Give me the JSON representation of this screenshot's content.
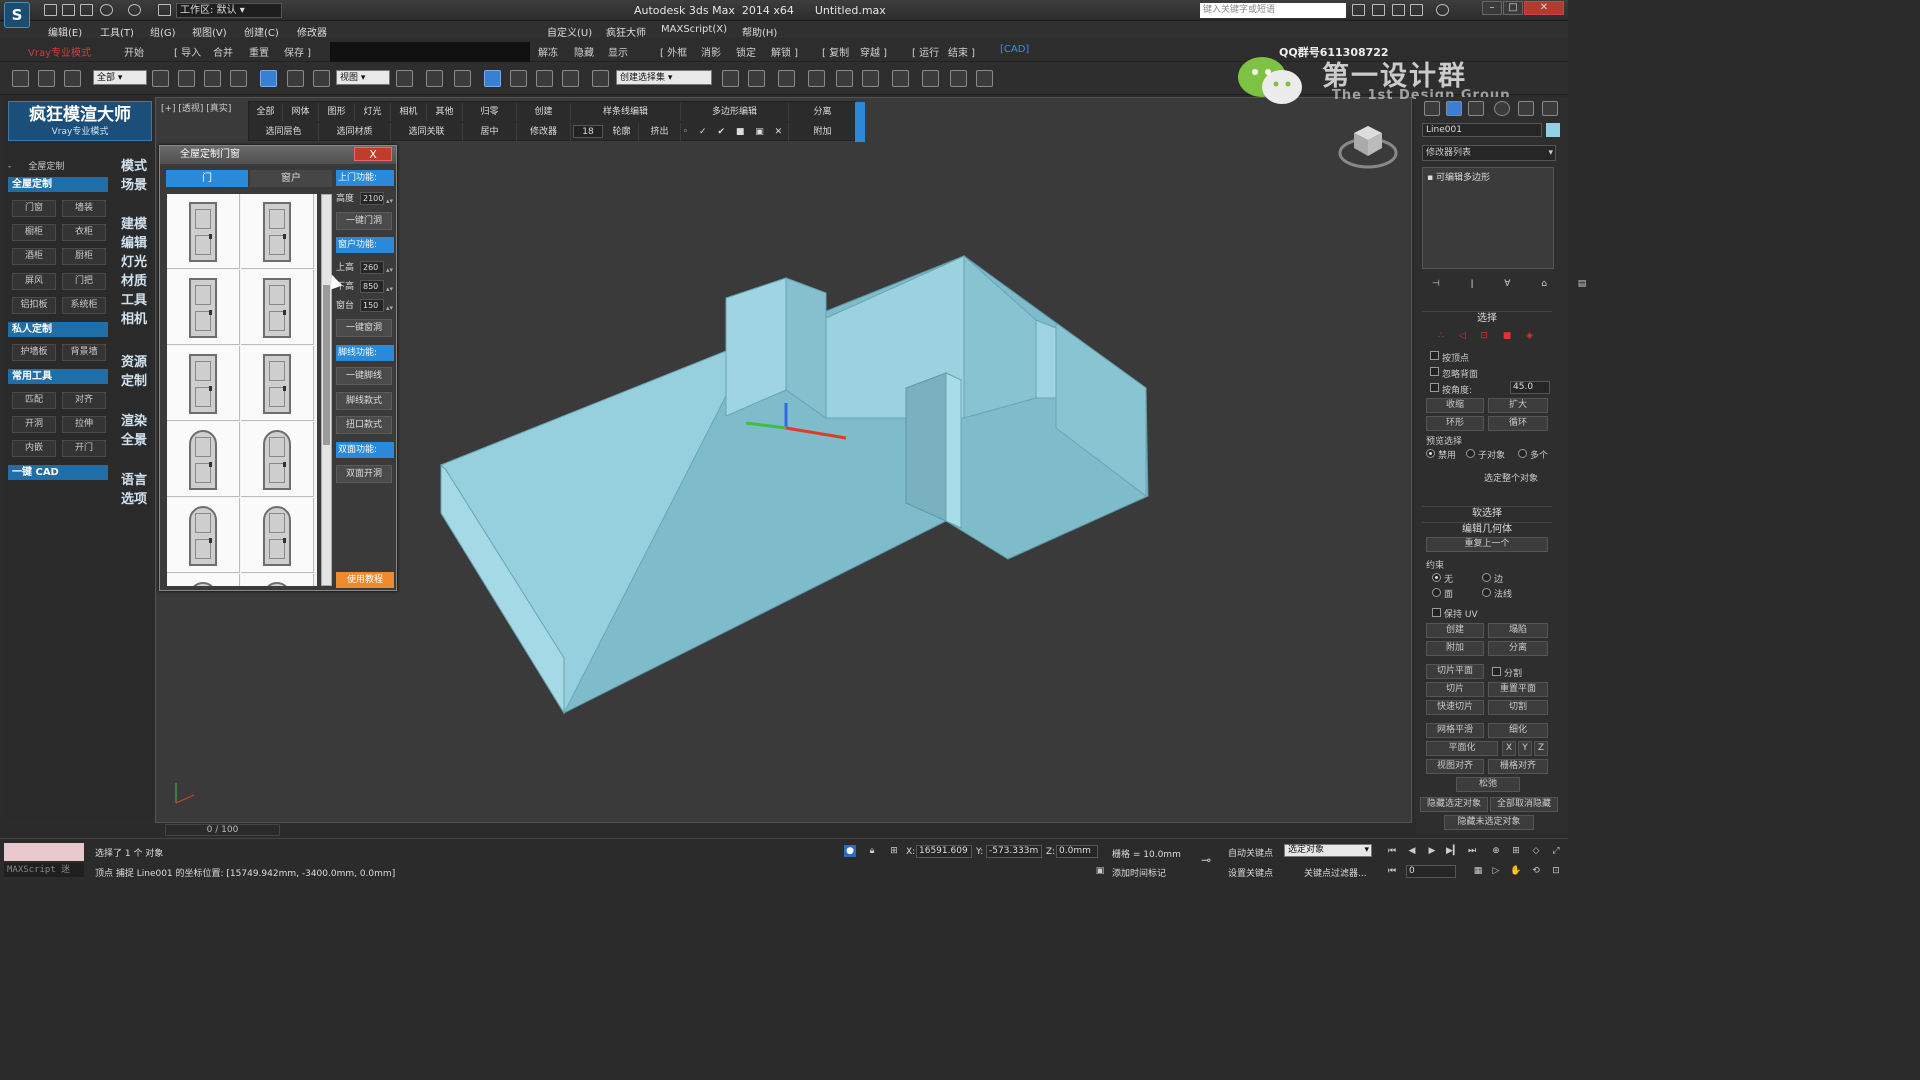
{
  "titlebar": {
    "workspace_prefix": "工作区:",
    "workspace_value": "默认",
    "app_title": "Autodesk 3ds Max  2014 x64",
    "file_name": "Untitled.max",
    "search_placeholder": "键入关键字或短语"
  },
  "menubar": {
    "items": [
      "编辑(E)",
      "工具(T)",
      "组(G)",
      "视图(V)",
      "创建(C)",
      "修改器",
      "自定义(U)",
      "疯狂大师",
      "MAXScript(X)",
      "帮助(H)"
    ]
  },
  "plugin_strip": {
    "items": [
      "开始",
      "[ 导入",
      "合并",
      "重置",
      "保存 ]",
      "解冻",
      "隐藏",
      "显示",
      "[ 外框",
      "消影",
      "锁定",
      "解锁 ]",
      "[ 复制",
      "穿越 ]",
      "[ 运行",
      "结束 ]",
      "[CAD]"
    ],
    "brand_text": "Vray专业模式"
  },
  "toolbar": {
    "filter_value": "全部",
    "ref_coord_value": "视图",
    "named_selection_value": "创建选择集"
  },
  "left_panel": {
    "brand_title": "疯狂模渲大师",
    "brand_subtitle": "Vray专业模式",
    "group_label": "全屋定制",
    "sections": [
      {
        "title": "全屋定制",
        "buttons": [
          "门窗",
          "墙装",
          "橱柜",
          "衣柜",
          "酒柜",
          "厨柜",
          "屏风",
          "门把",
          "铝扣板",
          "系统柜"
        ]
      },
      {
        "title": "私人定制",
        "buttons": [
          "护墙板",
          "背景墙"
        ]
      },
      {
        "title": "常用工具",
        "buttons": [
          "匹配",
          "对齐",
          "开洞",
          "拉伸",
          "内嵌",
          "开门"
        ]
      },
      {
        "title": "一键 CAD",
        "buttons": []
      }
    ],
    "side_labels": [
      "模式",
      "场景",
      "建模",
      "编辑",
      "灯光",
      "材质",
      "工具",
      "相机",
      "资源",
      "定制",
      "渲染",
      "全景",
      "语言",
      "选项"
    ]
  },
  "viewport": {
    "label": "[+] [透视] [真实]",
    "menu_row1": [
      "全部",
      "网体",
      "图形",
      "灯光",
      "相机",
      "其他",
      "归零",
      "创建",
      "样条线编辑",
      "多边形编辑",
      "分离"
    ],
    "menu_row2": [
      "选同层色",
      "选同材质",
      "选同关联",
      "居中",
      "修改器",
      "18",
      "轮廓",
      "挤出",
      "",
      "",
      "",
      "",
      "",
      "附加"
    ],
    "watermark_qq": "QQ群号611308722",
    "watermark_cn": "第一设计群",
    "watermark_en": "The 1st Design Group",
    "timeline": "0 / 100"
  },
  "dialog": {
    "title": "全屋定制门窗",
    "close_label": "X",
    "tabs": [
      "门",
      "窗户"
    ],
    "door_count": 12,
    "door_features_label": "上门功能:",
    "height_label": "高度",
    "height_value": "2100",
    "one_key_door": "一键门洞",
    "window_features_label": "窗户功能:",
    "top_height_label": "上高",
    "top_height_value": "260",
    "bottom_height_label": "下高",
    "bottom_height_value": "850",
    "sill_label": "窗台",
    "sill_value": "150",
    "one_key_window": "一键窗洞",
    "trim_features_label": "脚线功能:",
    "one_key_trim": "一键脚线",
    "trim_style": "脚线款式",
    "edge_style": "扭口款式",
    "double_features_label": "双面功能:",
    "double_open": "双面开洞",
    "tutorial": "使用教程"
  },
  "command_panel": {
    "object_name": "Line001",
    "modifier_list": "修改器列表",
    "stack_item": "可编辑多边形",
    "selection_title": "选择",
    "by_vertex": "按顶点",
    "ignore_back": "忽略背面",
    "by_angle": "按角度:",
    "angle_value": "45.0",
    "shrink": "收缩",
    "grow": "扩大",
    "ring": "环形",
    "loop": "循环",
    "preview_selection": "预览选择",
    "disabled": "禁用",
    "sub_object": "子对象",
    "multi": "多个",
    "select_whole": "选定整个对象",
    "soft_selection": "软选择",
    "edit_geometry": "编辑几何体",
    "repeat_last": "重复上一个",
    "constraints": "约束",
    "none": "无",
    "edge": "边",
    "face": "面",
    "normal": "法线",
    "preserve_uv": "保持 UV",
    "create": "创建",
    "collapse": "塌陷",
    "attach": "附加",
    "detach": "分离",
    "slice_plane": "切片平面",
    "split": "分割",
    "slice": "切片",
    "reset_plane": "重置平面",
    "quickslice": "快速切片",
    "cut": "切割",
    "meshsmooth": "网格平滑",
    "tessellate": "细化",
    "make_planar": "平面化",
    "x": "X",
    "y": "Y",
    "z": "Z",
    "view_align": "视图对齐",
    "grid_align": "栅格对齐",
    "relax": "松弛",
    "hide_selected": "隐藏选定对象",
    "unhide_all": "全部取消隐藏",
    "hide_unselected": "隐藏未选定对象"
  },
  "statusbar": {
    "maxscript_label": "MAXScript 迷",
    "selected_text": "选择了 1 个 对象",
    "prompt_text": "顶点 捕捉 Line001 的坐标位置: [15749.942mm, -3400.0mm, 0.0mm]",
    "x_label": "X:",
    "x_value": "16591.609",
    "y_label": "Y:",
    "y_value": "-573.333m",
    "z_label": "Z:",
    "z_value": "0.0mm",
    "grid_label": "栅格 = 10.0mm",
    "auto_key": "自动关键点",
    "set_key": "设置关键点",
    "selected_dropdown": "选定对象",
    "key_filters": "关键点过滤器...",
    "add_time_tag": "添加时间标记",
    "frame_value": "0"
  },
  "colors": {
    "accent": "#2a8ad9",
    "wall": "#8cc9d8",
    "floor": "#7db9c8",
    "close": "#c23c2a",
    "tutorial": "#f08a2e"
  }
}
